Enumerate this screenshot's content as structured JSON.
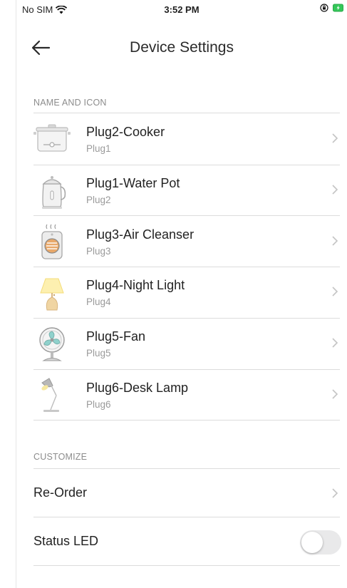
{
  "status_bar": {
    "carrier": "No SIM",
    "time": "3:52 PM",
    "wifi_icon": "wifi-icon",
    "lock_icon": "orientation-lock-icon",
    "battery_icon": "battery-charging-icon",
    "battery_color": "#34c759"
  },
  "nav": {
    "title": "Device Settings",
    "back_icon": "back-arrow-icon"
  },
  "name_and_icon": {
    "header": "NAME AND ICON",
    "devices": [
      {
        "name": "Plug2-Cooker",
        "sub": "Plug1",
        "icon": "cooker-icon"
      },
      {
        "name": "Plug1-Water Pot",
        "sub": "Plug2",
        "icon": "kettle-icon"
      },
      {
        "name": "Plug3-Air Cleanser",
        "sub": "Plug3",
        "icon": "air-purifier-icon"
      },
      {
        "name": "Plug4-Night Light",
        "sub": "Plug4",
        "icon": "night-light-icon"
      },
      {
        "name": "Plug5-Fan",
        "sub": "Plug5",
        "icon": "fan-icon"
      },
      {
        "name": "Plug6-Desk Lamp",
        "sub": "Plug6",
        "icon": "desk-lamp-icon"
      }
    ]
  },
  "customize": {
    "header": "CUSTOMIZE",
    "reorder_label": "Re-Order",
    "status_led_label": "Status LED",
    "status_led_on": false
  }
}
